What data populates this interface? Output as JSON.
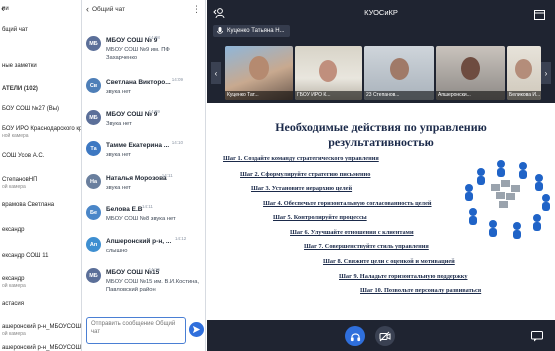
{
  "participants": {
    "header_chevron": "‹",
    "rows": [
      {
        "name": "ии",
        "sub": ""
      },
      {
        "name": "бщий чат",
        "sub": ""
      },
      {
        "name": "ные заметки",
        "sub": ""
      },
      {
        "name": "АТЕЛИ (102)",
        "sub": "",
        "section": true
      },
      {
        "name": "БОУ СОШ №27 (Вы)",
        "sub": ""
      },
      {
        "name": "БОУ ИРО Краснодарского края",
        "sub": "ной камера"
      },
      {
        "name": "СОШ Усов А.С.",
        "sub": ""
      },
      {
        "name": "СтепановНП",
        "sub": "ой камера"
      },
      {
        "name": "врамова Светлана",
        "sub": ""
      },
      {
        "name": "ександр",
        "sub": ""
      },
      {
        "name": "ександр СОШ 11",
        "sub": ""
      },
      {
        "name": "ександр",
        "sub": "ой камера"
      },
      {
        "name": "астасия",
        "sub": ""
      },
      {
        "name": "ашеронский р-н_МБОУСОШ...",
        "sub": "ой камера"
      },
      {
        "name": "ашеронский р-н_МБОУСОШ...",
        "sub": "ой камера"
      }
    ]
  },
  "chat": {
    "back_icon": "‹",
    "title": "Общий чат",
    "menu_icon": "⋮",
    "messages": [
      {
        "initials": "МБ",
        "color": "#5b6f99",
        "name": "МБОУ СОШ № 9",
        "time": "14:08",
        "text": "МБОУ СОШ №9 им. ПФ Захарченко"
      },
      {
        "initials": "Св",
        "color": "#4e7fb8",
        "name": "Светлана Викторо...",
        "time": "14:09",
        "text": "звука нет"
      },
      {
        "initials": "МБ",
        "color": "#5b6f99",
        "name": "МБОУ СОШ № 9",
        "time": "14:09",
        "text": "Звука нет"
      },
      {
        "initials": "Та",
        "color": "#3d78c2",
        "name": "Тамме Екатерина ...",
        "time": "14:10",
        "text": "звука нет"
      },
      {
        "initials": "На",
        "color": "#6a7f9e",
        "name": "Наталья Морозова",
        "time": "14:11",
        "text": "звука нет"
      },
      {
        "initials": "Бе",
        "color": "#4a86c8",
        "name": "Белова Е.В",
        "time": "14:11",
        "text": "МБОУ СОШ №8 звука нет"
      },
      {
        "initials": "Ап",
        "color": "#3e8fd1",
        "name": "Апшеронский р-н, ...",
        "time": "14:12",
        "text": "слышно"
      },
      {
        "initials": "МБ",
        "color": "#5b6f99",
        "name": "МБОУ СОШ №15",
        "time": "14:15",
        "text": "МБОУ СОШ №15 им. В.И.Костина, Павловский район"
      }
    ],
    "input_placeholder": "Отправить сообщение Общий чат"
  },
  "conference": {
    "title": "КУОСиКР",
    "speaker": "Куценко Татьяна Н...",
    "tiles": [
      {
        "caption": "Куценко Тат..."
      },
      {
        "caption": "ГБОУ ИРО К..."
      },
      {
        "caption": "23 Степанов..."
      },
      {
        "caption": "Апшеронски..."
      },
      {
        "caption": "Беликова И..."
      }
    ],
    "slide": {
      "title_line1": "Необходимые действия по управлению",
      "title_line2": "результативностью",
      "steps": [
        "Шаг 1. Создайте команду стратегического управления",
        "Шаг 2. Сформулируйте стратегию письменно",
        "Шаг 3. Установите иерархию целей",
        "Шаг 4. Обеспечьте горизонтальную согласованность целей",
        "Шаг 5. Контролируйте процессы",
        "Шаг 6. Улучшайте отношения с клиентами",
        "Шаг 7. Совершенствуйте стиль управления",
        "Шаг 8. Свяжите цели с оценкой и мотивацией",
        "Шаг 9. Наладьте горизонтальную поддержку",
        "Шаг 10. Позвольте персоналу развиваться"
      ]
    }
  }
}
